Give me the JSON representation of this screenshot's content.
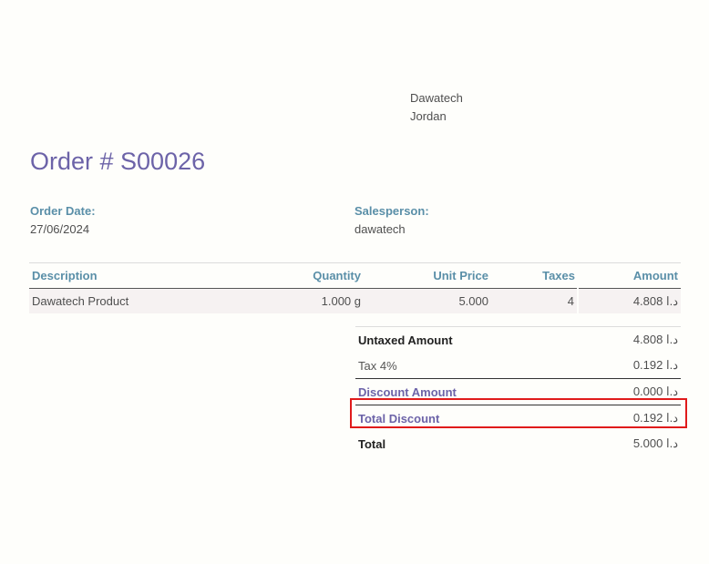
{
  "company": {
    "name": "Dawatech",
    "country": "Jordan"
  },
  "order": {
    "title": "Order # S00026"
  },
  "info": {
    "order_date_label": "Order Date:",
    "order_date": "27/06/2024",
    "salesperson_label": "Salesperson:",
    "salesperson": "dawatech"
  },
  "lines": {
    "headers": [
      "Description",
      "Quantity",
      "Unit Price",
      "Taxes",
      "Amount"
    ],
    "rows": [
      {
        "description": "Dawatech Product",
        "quantity": "1.000 g",
        "unit_price": "5.000",
        "taxes": "4",
        "amount": "4.808 د.ا"
      }
    ]
  },
  "totals": [
    {
      "label": "Untaxed Amount",
      "value": "4.808 د.ا"
    },
    {
      "label": "Tax 4%",
      "value": "0.192 د.ا"
    },
    {
      "label": "Discount Amount",
      "value": "0.000 د.ا"
    },
    {
      "label": "Total Discount",
      "value": "0.192 د.ا"
    },
    {
      "label": "Total",
      "value": "5.000 د.ا"
    }
  ],
  "colors": {
    "accent": "#6c63a8",
    "label_blue": "#5a8fa8",
    "highlight": "#e01b1b"
  }
}
